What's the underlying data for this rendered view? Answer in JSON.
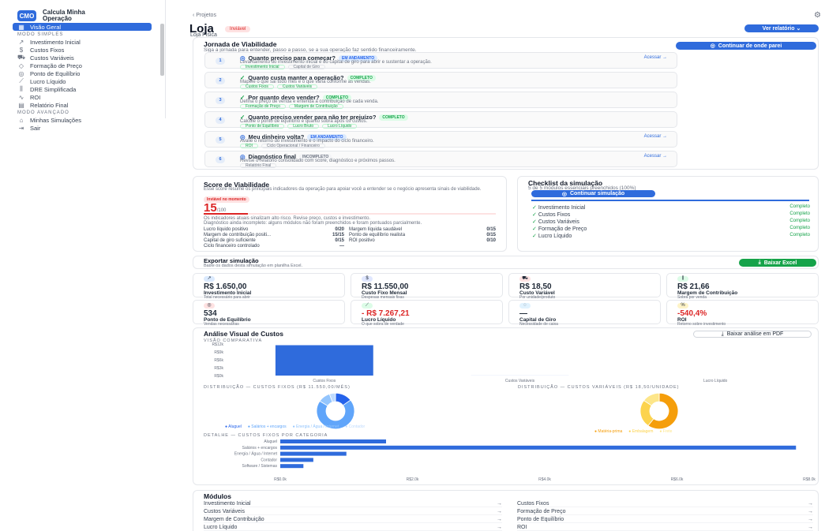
{
  "sidebar": {
    "app_title": "Calcula Minha Operação",
    "logo": "CMO",
    "items": [
      {
        "label": "Visão Geral",
        "icon": "grid-icon",
        "glyph": "▦",
        "active": true
      },
      {
        "section": "MODO SIMPLES"
      },
      {
        "label": "Investimento Inicial",
        "icon": "trend-icon",
        "glyph": "↗"
      },
      {
        "label": "Custos Fixos",
        "icon": "dollar-icon",
        "glyph": "$"
      },
      {
        "label": "Custos Variáveis",
        "icon": "cart-icon",
        "glyph": "⛟"
      },
      {
        "label": "Formação de Preço",
        "icon": "tag-icon",
        "glyph": "◇"
      },
      {
        "label": "Ponto de Equilíbrio",
        "icon": "target-icon",
        "glyph": "◎"
      },
      {
        "label": "Lucro Líquido",
        "icon": "chart-icon",
        "glyph": "⟋"
      },
      {
        "label": "DRE Simplificada",
        "icon": "bars-icon",
        "glyph": "⫼"
      },
      {
        "label": "ROI",
        "icon": "pulse-icon",
        "glyph": "∿"
      },
      {
        "label": "Relatório Final",
        "icon": "report-icon",
        "glyph": "▤"
      },
      {
        "section": "MODO AVANÇADO"
      },
      {
        "label": "Minhas Simulações",
        "icon": "folder-icon",
        "glyph": "⌂"
      },
      {
        "label": "Sair",
        "icon": "logout-icon",
        "glyph": "⇥"
      }
    ]
  },
  "header": {
    "breadcrumb": "‹ Projetos",
    "title": "Loja",
    "status": "Inviável",
    "subtitle": "Loja Física",
    "report_button": "Ver relatório ⌄"
  },
  "journey": {
    "title": "Jornada de Viabilidade",
    "subtitle": "Siga a jornada para entender, passo a passo, se a sua operação faz sentido financeiramente.",
    "continue": "Continuar de onde parei",
    "steps": [
      {
        "n": "1",
        "title": "Quanto preciso para começar?",
        "tag": "EM ANDAMENTO",
        "tagc": "b",
        "desc": "Levantamento do investimento inicial e do capital de giro para abrir e sustentar a operação.",
        "chips": [
          "Investimento Inicial",
          "Capital de Giro"
        ],
        "chipgray": [
          false,
          true
        ],
        "link": "Acessar →"
      },
      {
        "n": "2",
        "title": "Quanto custa manter a operação?",
        "tag": "COMPLETO",
        "tagc": "g",
        "desc": "Mapeie o que sai todo mês e o que varia conforme as vendas.",
        "chips": [
          "Custos Fixos",
          "Custos Variáveis"
        ],
        "chipgray": [
          false,
          false
        ],
        "link": ""
      },
      {
        "n": "3",
        "title": "Por quanto devo vender?",
        "tag": "COMPLETO",
        "tagc": "g",
        "desc": "Defina o preço de venda e entenda a contribuição de cada venda.",
        "chips": [
          "Formação de Preço",
          "Margem de Contribuição"
        ],
        "chipgray": [
          false,
          false
        ],
        "link": ""
      },
      {
        "n": "4",
        "title": "Quanto preciso vender para não ter prejuízo?",
        "tag": "COMPLETO",
        "tagc": "g",
        "desc": "Calcule o ponto de equilíbrio e quanto sobra após os custos.",
        "chips": [
          "Ponto de Equilíbrio",
          "Lucro Bruto",
          "Lucro Líquido"
        ],
        "chipgray": [
          false,
          false,
          false
        ],
        "link": ""
      },
      {
        "n": "5",
        "title": "Meu dinheiro volta?",
        "tag": "EM ANDAMENTO",
        "tagc": "b",
        "desc": "Avalie o retorno do investimento e o impacto do ciclo financeiro.",
        "chips": [
          "ROI",
          "Ciclo Operacional / Financeiro"
        ],
        "chipgray": [
          false,
          true
        ],
        "link": "Acessar →"
      },
      {
        "n": "6",
        "title": "Diagnóstico final",
        "tag": "INCOMPLETO",
        "tagc": "gr",
        "desc": "Revise o relatório consolidado com score, diagnóstico e próximos passos.",
        "chips": [
          "Relatório Final"
        ],
        "chipgray": [
          true
        ],
        "link": "Acessar →"
      }
    ]
  },
  "score": {
    "title": "Score de Viabilidade",
    "desc": "Esse score resume os principais indicadores da operação para apoiar você a entender se o negócio apresenta sinais de viabilidade.",
    "status": "Inviável no momento",
    "value": "15",
    "max": "/100",
    "note1": "Os indicadores atuais sinalizam alto risco. Revise preço, custos e investimento.",
    "note2": "Diagnóstico ainda incompleto: alguns módulos não foram preenchidos e foram pontuados parcialmente.",
    "rows": [
      {
        "l": "Lucro líquido positivo",
        "v": "0/20",
        "l2": "Margem líquida saudável",
        "v2": "0/15"
      },
      {
        "l": "Margem de contribuição positi...",
        "v": "15/15",
        "l2": "Ponto de equilíbrio realista",
        "v2": "0/15"
      },
      {
        "l": "Capital de giro suficiente",
        "v": "0/15",
        "l2": "ROI positivo",
        "v2": "0/10"
      },
      {
        "l": "Ciclo financeiro controlado",
        "v": "—",
        "l2": "",
        "v2": ""
      }
    ]
  },
  "checklist": {
    "title": "Checklist da simulação",
    "subtitle": "5 de 5 módulos essenciais preenchidos (100%)",
    "button": "Continuar simulação",
    "progress": 1.0,
    "items": [
      {
        "l": "Investimento Inicial",
        "s": "Completo"
      },
      {
        "l": "Custos Fixos",
        "s": "Completo"
      },
      {
        "l": "Custos Variáveis",
        "s": "Completo"
      },
      {
        "l": "Formação de Preço",
        "s": "Completo"
      },
      {
        "l": "Lucro Líquido",
        "s": "Completo"
      }
    ]
  },
  "export": {
    "title": "Exportar simulação",
    "subtitle": "Baixe os dados desta simulação em planilha Excel.",
    "button": "Baixar Excel"
  },
  "kpis": [
    {
      "v": "R$ 1.650,00",
      "l": "Investimento Inicial",
      "s": "Total necessário para abrir",
      "c": "#dbeafe",
      "g": "↗"
    },
    {
      "v": "R$ 11.550,00",
      "l": "Custo Fixo Mensal",
      "s": "Despesas mensais fixas",
      "c": "#e0e7ff",
      "g": "$"
    },
    {
      "v": "R$ 18,50",
      "l": "Custo Variável",
      "s": "Por unidade/produto",
      "c": "#fde2e2",
      "g": "⛟"
    },
    {
      "v": "R$ 21,66",
      "l": "Margem de Contribuição",
      "s": "Sobra por venda",
      "c": "#dcfce7",
      "g": "⫼"
    },
    {
      "v": "534",
      "l": "Ponto de Equilíbrio",
      "s": "Vendas necessárias",
      "c": "#fee2e2",
      "g": "◎"
    },
    {
      "v": "- R$ 7.267,21",
      "l": "Lucro Líquido",
      "s": "O que sobra de verdade",
      "c": "#dcfce7",
      "g": "⟋"
    },
    {
      "v": "—",
      "l": "Capital de Giro",
      "s": "Necessidade de caixa",
      "c": "#e0f2fe",
      "g": "◌"
    },
    {
      "v": "-540,4%",
      "l": "ROI",
      "s": "Retorno sobre investimento",
      "c": "#fef3c7",
      "g": "%"
    }
  ],
  "analysis": {
    "title": "Análise Visual de Custos",
    "pdf": "Baixar análise em PDF",
    "comp_title": "VISÃO COMPARATIVA",
    "fixed_title": "DISTRIBUIÇÃO — CUSTOS FIXOS (R$ 11.550,00/MÊS)",
    "var_title": "DISTRIBUIÇÃO — CUSTOS VARIÁVEIS (R$ 18,50/UNIDADE)",
    "detail_title": "DETALHE — CUSTOS FIXOS POR CATEGORIA"
  },
  "chart_data": [
    {
      "type": "bar",
      "title": "VISÃO COMPARATIVA",
      "categories": [
        "Custos Fixos",
        "Custos Variáveis",
        "Lucro Líquido"
      ],
      "values": [
        11550,
        18.5,
        0
      ],
      "y_ticks": [
        "R$12k",
        "R$9k",
        "R$6k",
        "R$3k",
        "R$0k"
      ],
      "ylim": [
        0,
        12000
      ],
      "color": "#2f6bdc"
    },
    {
      "type": "pie",
      "title": "DISTRIBUIÇÃO — CUSTOS FIXOS (R$ 11.550,00/MÊS)",
      "labels": [
        "Aluguel",
        "Salários + encargos",
        "Energia / Água / Internet",
        "Contador"
      ],
      "values": [
        14,
        67,
        10,
        5
      ],
      "colors": [
        "#2563eb",
        "#60a5fa",
        "#93c5fd",
        "#bfdbfe"
      ]
    },
    {
      "type": "pie",
      "title": "DISTRIBUIÇÃO — CUSTOS VARIÁVEIS (R$ 18,50/UNIDADE)",
      "labels": [
        "Matéria-prima",
        "Embalagem",
        "Frete"
      ],
      "values": [
        60,
        25,
        15
      ],
      "colors": [
        "#f59e0b",
        "#fcd34d",
        "#fde68a"
      ]
    },
    {
      "type": "bar",
      "orientation": "horizontal",
      "title": "DETALHE — CUSTOS FIXOS POR CATEGORIA",
      "categories": [
        "Aluguel",
        "Salários + encargos",
        "Energia / Água / Internet",
        "Contador",
        "Software / Sistemas"
      ],
      "values": [
        1600,
        7800,
        1000,
        500,
        350
      ],
      "x_ticks": [
        "R$0.0k",
        "R$2.0k",
        "R$4.0k",
        "R$6.0k",
        "R$8.0k"
      ],
      "xlim": [
        0,
        8000
      ],
      "color": "#2f6bdc"
    }
  ],
  "modules": {
    "title": "Módulos",
    "left": [
      "Investimento Inicial",
      "Custos Variáveis",
      "Margem de Contribuição",
      "Lucro Líquido"
    ],
    "right": [
      "Custos Fixos",
      "Formação de Preço",
      "Ponto de Equilíbrio",
      "ROI"
    ]
  }
}
